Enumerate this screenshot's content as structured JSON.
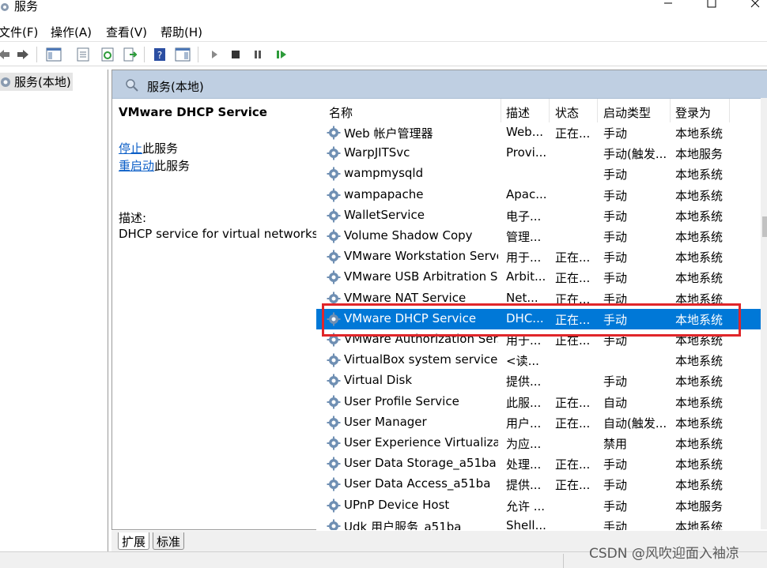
{
  "window": {
    "title": "服务",
    "minimize_label": "─",
    "maximize_label": "☐",
    "close_label": "✕"
  },
  "menu": {
    "items": [
      "文件(F)",
      "操作(A)",
      "查看(V)",
      "帮助(H)"
    ]
  },
  "toolbar": {
    "icons": [
      "back-icon",
      "forward-icon",
      "show-hide-tree-icon",
      "properties-icon",
      "refresh-icon",
      "export-list-icon",
      "help-icon",
      "show-hide-action-pane-icon",
      "start-service-icon",
      "stop-service-icon",
      "pause-service-icon",
      "restart-service-icon"
    ]
  },
  "tree": {
    "root_label": "服务(本地)"
  },
  "pane": {
    "header_title": "服务(本地)"
  },
  "details": {
    "service_name": "VMware DHCP Service",
    "stop_link": "停止",
    "stop_suffix": "此服务",
    "restart_link": "重启动",
    "restart_suffix": "此服务",
    "description_label": "描述:",
    "description_text": "DHCP service for virtual networks."
  },
  "list": {
    "columns": [
      "名称",
      "描述",
      "状态",
      "启动类型",
      "登录为"
    ],
    "rows": [
      {
        "name": "Web 帐户管理器",
        "desc": "Web...",
        "status": "正在...",
        "startup": "手动",
        "logon": "本地系统"
      },
      {
        "name": "WarpJITSvc",
        "desc": "Provi...",
        "status": "",
        "startup": "手动(触发...",
        "logon": "本地服务"
      },
      {
        "name": "wampmysqld",
        "desc": "",
        "status": "",
        "startup": "手动",
        "logon": "本地系统"
      },
      {
        "name": "wampapache",
        "desc": "Apac...",
        "status": "",
        "startup": "手动",
        "logon": "本地系统"
      },
      {
        "name": "WalletService",
        "desc": "电子...",
        "status": "",
        "startup": "手动",
        "logon": "本地系统"
      },
      {
        "name": "Volume Shadow Copy",
        "desc": "管理...",
        "status": "",
        "startup": "手动",
        "logon": "本地系统"
      },
      {
        "name": "VMware Workstation Server",
        "desc": "用于...",
        "status": "正在...",
        "startup": "手动",
        "logon": "本地系统"
      },
      {
        "name": "VMware USB Arbitration S...",
        "desc": "Arbit...",
        "status": "正在...",
        "startup": "手动",
        "logon": "本地系统"
      },
      {
        "name": "VMware NAT Service",
        "desc": "Net...",
        "status": "正在...",
        "startup": "手动",
        "logon": "本地系统"
      },
      {
        "name": "VMware DHCP Service",
        "desc": "DHC...",
        "status": "正在...",
        "startup": "手动",
        "logon": "本地系统",
        "selected": true
      },
      {
        "name": "VMware Authorization Ser...",
        "desc": "用于...",
        "status": "正在...",
        "startup": "手动",
        "logon": "本地系统"
      },
      {
        "name": "VirtualBox system service",
        "desc": "<读...",
        "status": "",
        "startup": "",
        "logon": "本地系统"
      },
      {
        "name": "Virtual Disk",
        "desc": "提供...",
        "status": "",
        "startup": "手动",
        "logon": "本地系统"
      },
      {
        "name": "User Profile Service",
        "desc": "此服...",
        "status": "正在...",
        "startup": "自动",
        "logon": "本地系统"
      },
      {
        "name": "User Manager",
        "desc": "用户...",
        "status": "正在...",
        "startup": "自动(触发...",
        "logon": "本地系统"
      },
      {
        "name": "User Experience Virtualizat...",
        "desc": "为应...",
        "status": "",
        "startup": "禁用",
        "logon": "本地系统"
      },
      {
        "name": "User Data Storage_a51ba",
        "desc": "处理...",
        "status": "正在...",
        "startup": "手动",
        "logon": "本地系统"
      },
      {
        "name": "User Data Access_a51ba",
        "desc": "提供...",
        "status": "正在...",
        "startup": "手动",
        "logon": "本地系统"
      },
      {
        "name": "UPnP Device Host",
        "desc": "允许 ...",
        "status": "",
        "startup": "手动",
        "logon": "本地服务"
      },
      {
        "name": "Udk 用户服务_a51ba",
        "desc": "Shell...",
        "status": "",
        "startup": "手动",
        "logon": "本地系统"
      }
    ]
  },
  "tabs": {
    "extended": "扩展",
    "standard": "标准"
  },
  "watermark": "CSDN @风吹迎面入袖凉",
  "colors": {
    "selection": "#0078d7",
    "header_bg": "#bfcfe2",
    "highlight_border": "#e0262a",
    "link": "#0b5ec7"
  }
}
